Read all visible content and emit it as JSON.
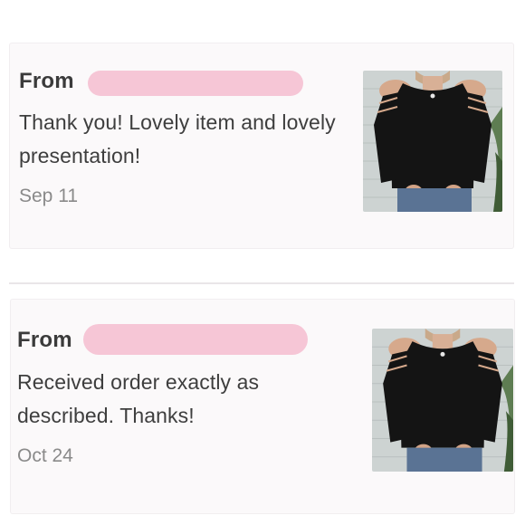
{
  "reviews": [
    {
      "from_label": "From",
      "text": "Thank you! Lovely item and lovely presentation!",
      "date": "Sep 11"
    },
    {
      "from_label": "From",
      "text": "Received order exactly as described. Thanks!",
      "date": "Oct 24"
    }
  ],
  "colors": {
    "card_bg": "#fbf9fa",
    "redaction": "#f6c6d6",
    "text": "#3e3e3e",
    "date": "#8a8a8a"
  }
}
